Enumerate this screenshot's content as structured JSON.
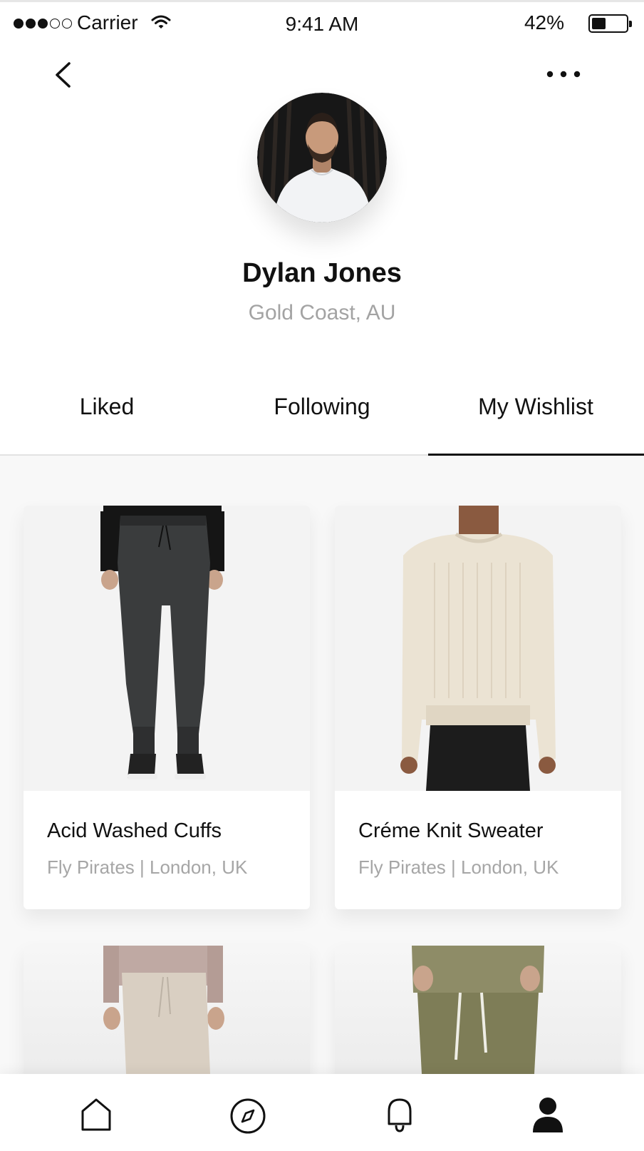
{
  "status_bar": {
    "carrier": "Carrier",
    "time": "9:41 AM",
    "battery_percent": "42%",
    "signal_strength_bars": 3,
    "signal_total_bars": 5,
    "battery_level": 0.42
  },
  "nav": {
    "back_icon": "chevron-left-icon",
    "more_icon": "ellipsis-horizontal-icon"
  },
  "profile": {
    "name": "Dylan Jones",
    "location": "Gold Coast, AU"
  },
  "tabs": [
    {
      "label": "Liked",
      "active": false
    },
    {
      "label": "Following",
      "active": false
    },
    {
      "label": "My Wishlist",
      "active": true
    }
  ],
  "wishlist": [
    {
      "title": "Acid Washed Cuffs",
      "meta": "Fly Pirates | London, UK"
    },
    {
      "title": "Créme Knit Sweater",
      "meta": "Fly Pirates | London, UK"
    },
    {
      "title": "",
      "meta": ""
    },
    {
      "title": "",
      "meta": ""
    }
  ],
  "tabbar": [
    {
      "icon": "home-icon",
      "active": false
    },
    {
      "icon": "compass-icon",
      "active": false
    },
    {
      "icon": "bell-icon",
      "active": false
    },
    {
      "icon": "profile-icon",
      "active": true
    }
  ],
  "colors": {
    "text_primary": "#111111",
    "text_secondary": "#a3a3a3",
    "background_grid": "#f8f8f8",
    "accent": "#111111"
  }
}
